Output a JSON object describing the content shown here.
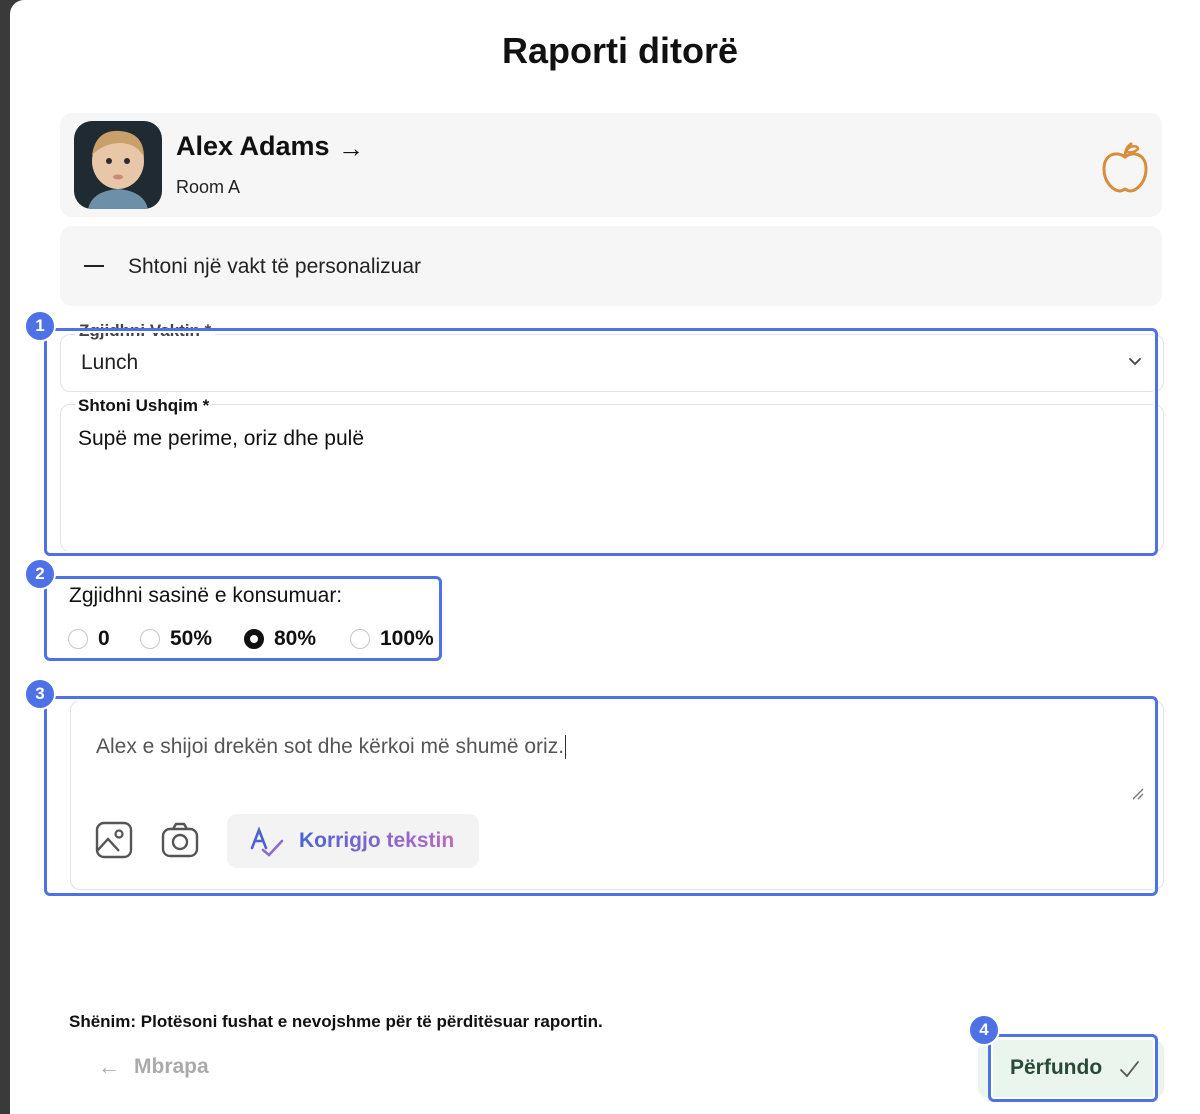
{
  "modal": {
    "title": "Raporti ditorë"
  },
  "child": {
    "name": "Alex Adams",
    "room": "Room A",
    "icon": "apple-icon",
    "accent": "#d98c3a"
  },
  "custom_meal": {
    "label": "Shtoni një vakt të personalizuar",
    "icon": "minus-icon"
  },
  "meal_select": {
    "label": "Zgjidhni Vaktin *",
    "value": "Lunch"
  },
  "food_input": {
    "label": "Shtoni Ushqim *",
    "value": "Supë me perime, oriz dhe pulë"
  },
  "amount": {
    "label": "Zgjidhni sasinë e konsumuar:",
    "options": [
      "0",
      "50%",
      "80%",
      "100%"
    ],
    "selected": "80%"
  },
  "note": {
    "value": "Alex e shijoi drekën sot dhe kërkoi më shumë oriz.",
    "fix_text_label": "Korrigjo tekstin"
  },
  "footer": {
    "note": "Shënim: Plotësoni fushat e nevojshme për të përditësuar raportin.",
    "back_label": "Mbrapa",
    "finish_label": "Përfundo"
  },
  "annotations": [
    "1",
    "2",
    "3",
    "4"
  ],
  "colors": {
    "annotation": "#4e72e6",
    "finish_bg": "#eaf5ee"
  }
}
